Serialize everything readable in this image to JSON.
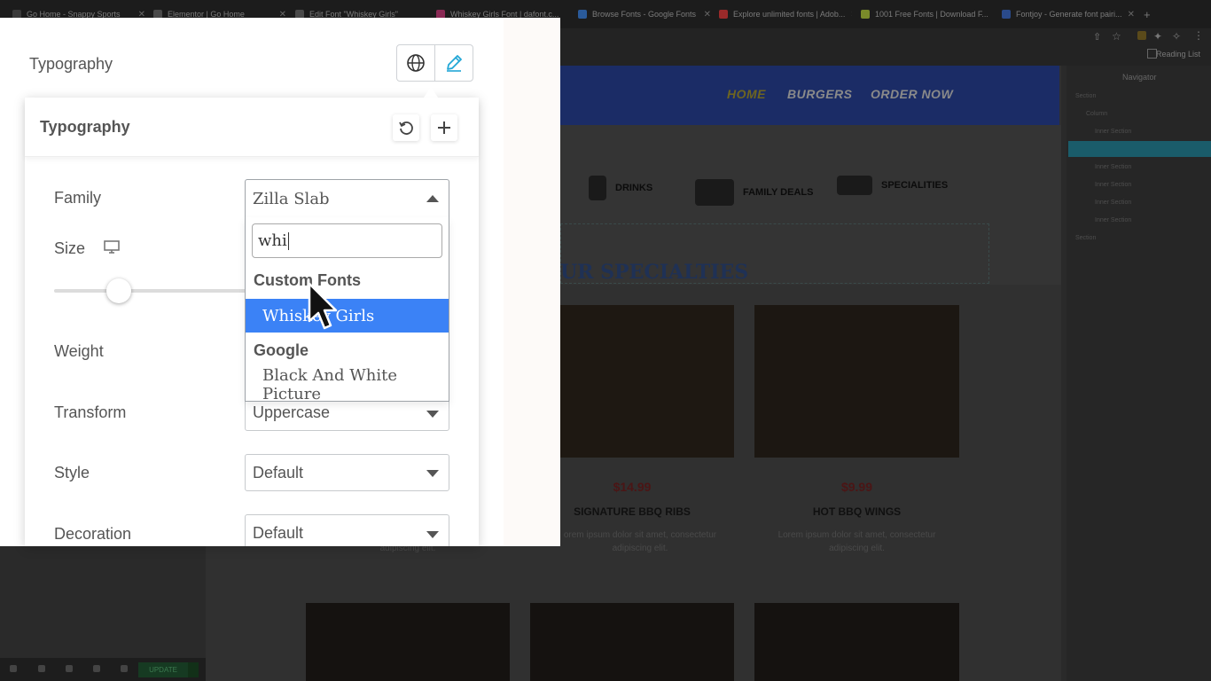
{
  "browser": {
    "tabs": [
      {
        "title": "Go Home - Snappy Sports",
        "color": "#3a3a3a"
      },
      {
        "title": "Elementor | Go Home",
        "color": "#4a4a4a"
      },
      {
        "title": "Edit Font \"Whiskey Girls\"",
        "color": "#4a4a4a"
      },
      {
        "title": "Whiskey Girls Font | dafont.c...",
        "color": "#8a2a55"
      },
      {
        "title": "Browse Fonts - Google Fonts",
        "color": "#2a5a9a"
      },
      {
        "title": "Explore unlimited fonts | Adob...",
        "color": "#9a2a2a"
      },
      {
        "title": "1001 Free Fonts | Download F...",
        "color": "#7a8a2a"
      },
      {
        "title": "Fontjoy - Generate font pairi...",
        "color": "#2a4a8a"
      }
    ],
    "reading_list": "Reading List"
  },
  "site": {
    "nav": [
      {
        "label": "HOME"
      },
      {
        "label": "BURGERS"
      },
      {
        "label": "ORDER NOW"
      }
    ],
    "categories": [
      {
        "label": "DRINKS"
      },
      {
        "label": "FAMILY DEALS"
      },
      {
        "label": "SPECIALITIES"
      }
    ],
    "section_heading": "UR SPECIALTIES",
    "items": [
      {
        "price": "$14.99",
        "name": "SIGNATURE BBQ RIBS",
        "desc1": "orem ipsum dolor sit amet, consectetur",
        "desc2": "adipiscing elit."
      },
      {
        "price": "$9.99",
        "name": "HOT BBQ WINGS",
        "desc1": "Lorem ipsum dolor sit amet, consectetur",
        "desc2": "adipiscing elit."
      }
    ],
    "left_desc_fragment": "adipiscing elit."
  },
  "navigator": {
    "title": "Navigator",
    "rows": [
      "Section",
      "Column",
      "Inner Section",
      "",
      "Inner Section",
      "Inner Section",
      "Inner Section",
      "Inner Section",
      "Section"
    ]
  },
  "bottom_bar": {
    "update_label": "UPDATE"
  },
  "panel": {
    "section_label": "Typography",
    "popover_title": "Typography",
    "fields": {
      "family_label": "Family",
      "family_value": "Zilla Slab",
      "size_label": "Size",
      "weight_label": "Weight",
      "transform_label": "Transform",
      "transform_value": "Uppercase",
      "style_label": "Style",
      "style_value": "Default",
      "decoration_label": "Decoration",
      "decoration_value": "Default"
    },
    "dropdown": {
      "search_value": "whi",
      "group_custom": "Custom Fonts",
      "option_custom": "Whiskey Girls",
      "group_google": "Google",
      "option_google": "Black And White Picture"
    }
  },
  "colors": {
    "accent": "#3b82f6",
    "pencil": "#22a7d6",
    "price": "#8b1a1a",
    "site_nav": "#1b2c66"
  }
}
